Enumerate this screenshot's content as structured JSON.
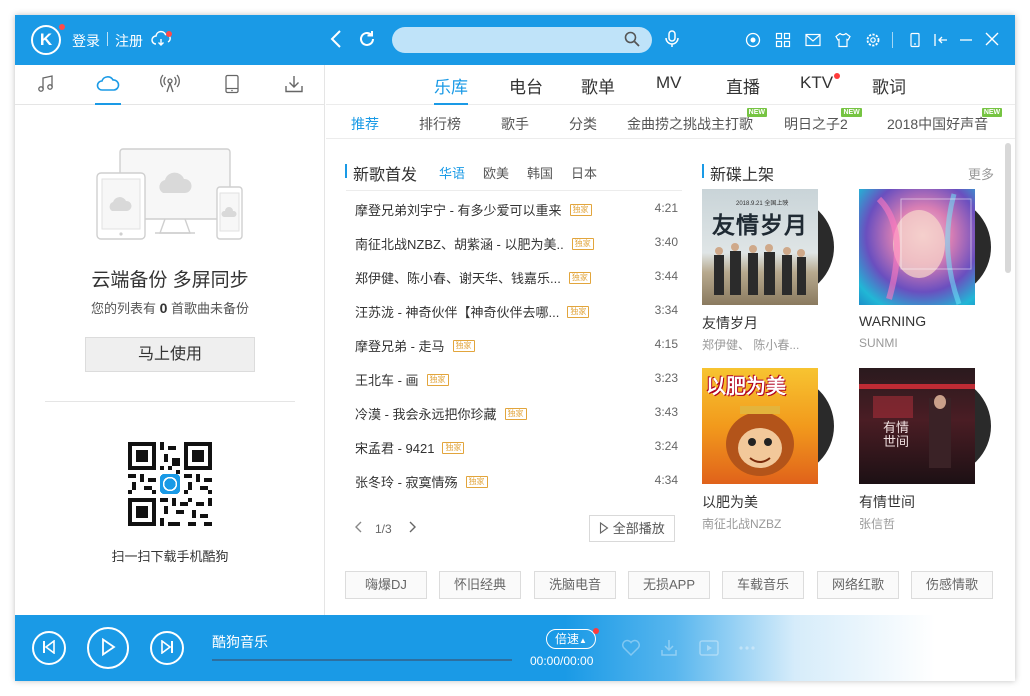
{
  "titlebar": {
    "logo": "K",
    "login": "登录",
    "register": "注册",
    "search_placeholder": ""
  },
  "sidebar": {
    "tabs": [
      "music-note-icon",
      "cloud-icon",
      "radio-icon",
      "mobile-icon",
      "download-icon"
    ],
    "active_tab": 1,
    "cloud_title": "云端备份 多屏同步",
    "cloud_sub_prefix": "您的列表有",
    "cloud_count": "0",
    "cloud_sub_suffix": "首歌曲未备份",
    "use_button": "马上使用",
    "qr_label": "扫一扫下载手机酷狗"
  },
  "main_nav": {
    "items": [
      "乐库",
      "电台",
      "歌单",
      "MV",
      "直播",
      "KTV",
      "歌词"
    ],
    "active": 0
  },
  "sub_nav": {
    "items": [
      "推荐",
      "排行榜",
      "歌手",
      "分类",
      "金曲捞之挑战主打歌",
      "明日之子2",
      "2018中国好声音"
    ],
    "new_badge": "NEW",
    "active": 0
  },
  "new_songs": {
    "title": "新歌首发",
    "langs": [
      "华语",
      "欧美",
      "韩国",
      "日本"
    ],
    "active_lang": 0,
    "hq_label": "独家",
    "songs": [
      {
        "name": "摩登兄弟刘宇宁 - 有多少爱可以重来",
        "dur": "4:21"
      },
      {
        "name": "南征北战NZBZ、胡紫涵 - 以肥为美..",
        "dur": "3:40"
      },
      {
        "name": "郑伊健、陈小春、谢天华、钱嘉乐...",
        "dur": "3:44"
      },
      {
        "name": "汪苏泷 - 神奇伙伴【神奇伙伴去哪...",
        "dur": "3:34"
      },
      {
        "name": "摩登兄弟 - 走马",
        "dur": "4:15"
      },
      {
        "name": "王北车 - 画",
        "dur": "3:23"
      },
      {
        "name": "冷漠 - 我会永远把你珍藏",
        "dur": "3:43"
      },
      {
        "name": "宋孟君 - 9421",
        "dur": "3:24"
      },
      {
        "name": "张冬玲 - 寂寞情殇",
        "dur": "4:34"
      }
    ],
    "page": "1/3",
    "play_all": "全部播放"
  },
  "albums": {
    "title": "新碟上架",
    "more": "更多",
    "items": [
      {
        "title": "友情岁月",
        "artist": "郑伊健、 陈小春...",
        "cover_text": "友情岁月",
        "cover_small": "2018.9.21 全国上映"
      },
      {
        "title": "WARNING",
        "artist": "SUNMI",
        "cover_text": "",
        "cover_small": ""
      },
      {
        "title": "以肥为美",
        "artist": "南征北战NZBZ",
        "cover_text": "以肥为美",
        "cover_small": ""
      },
      {
        "title": "有情世间",
        "artist": "张信哲",
        "cover_text": "有情世间",
        "cover_small": ""
      }
    ]
  },
  "tags": [
    "嗨爆DJ",
    "怀旧经典",
    "洗脑电音",
    "无损APP",
    "车载音乐",
    "网络红歌",
    "伤感情歌"
  ],
  "player": {
    "title": "酷狗音乐",
    "speed": "倍速",
    "time": "00:00/00:00"
  },
  "colors": {
    "accent": "#1a9ae6",
    "hq": "#e2a53c",
    "new_badge": "#76c442",
    "dot": "#ff3b3b"
  }
}
